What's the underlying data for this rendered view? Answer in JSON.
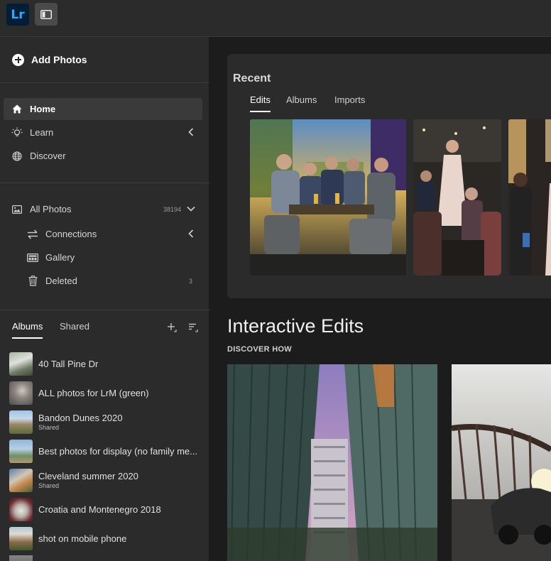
{
  "app": {
    "logo_text": "Lr",
    "accent_color": "#31a8ff"
  },
  "sidebar": {
    "add_photos_label": "Add Photos",
    "nav": {
      "home": "Home",
      "learn": "Learn",
      "discover": "Discover"
    },
    "library": {
      "all_photos": "All Photos",
      "all_photos_count": "38194",
      "connections": "Connections",
      "gallery": "Gallery",
      "deleted": "Deleted",
      "deleted_count": "3"
    },
    "album_tabs": {
      "albums": "Albums",
      "shared": "Shared"
    },
    "albums": [
      {
        "name": "40 Tall Pine Dr",
        "shared": ""
      },
      {
        "name": "ALL photos for LrM (green)",
        "shared": ""
      },
      {
        "name": "Bandon Dunes 2020",
        "shared": "Shared"
      },
      {
        "name": "Best photos for display (no family me...",
        "shared": ""
      },
      {
        "name": "Cleveland summer 2020",
        "shared": "Shared"
      },
      {
        "name": "Croatia and Montenegro 2018",
        "shared": ""
      },
      {
        "name": "shot on mobile phone",
        "shared": ""
      }
    ]
  },
  "main": {
    "recent": {
      "title": "Recent",
      "tabs": [
        "Edits",
        "Albums",
        "Imports"
      ]
    },
    "interactive": {
      "title": "Interactive Edits",
      "subtitle": "DISCOVER HOW"
    }
  }
}
